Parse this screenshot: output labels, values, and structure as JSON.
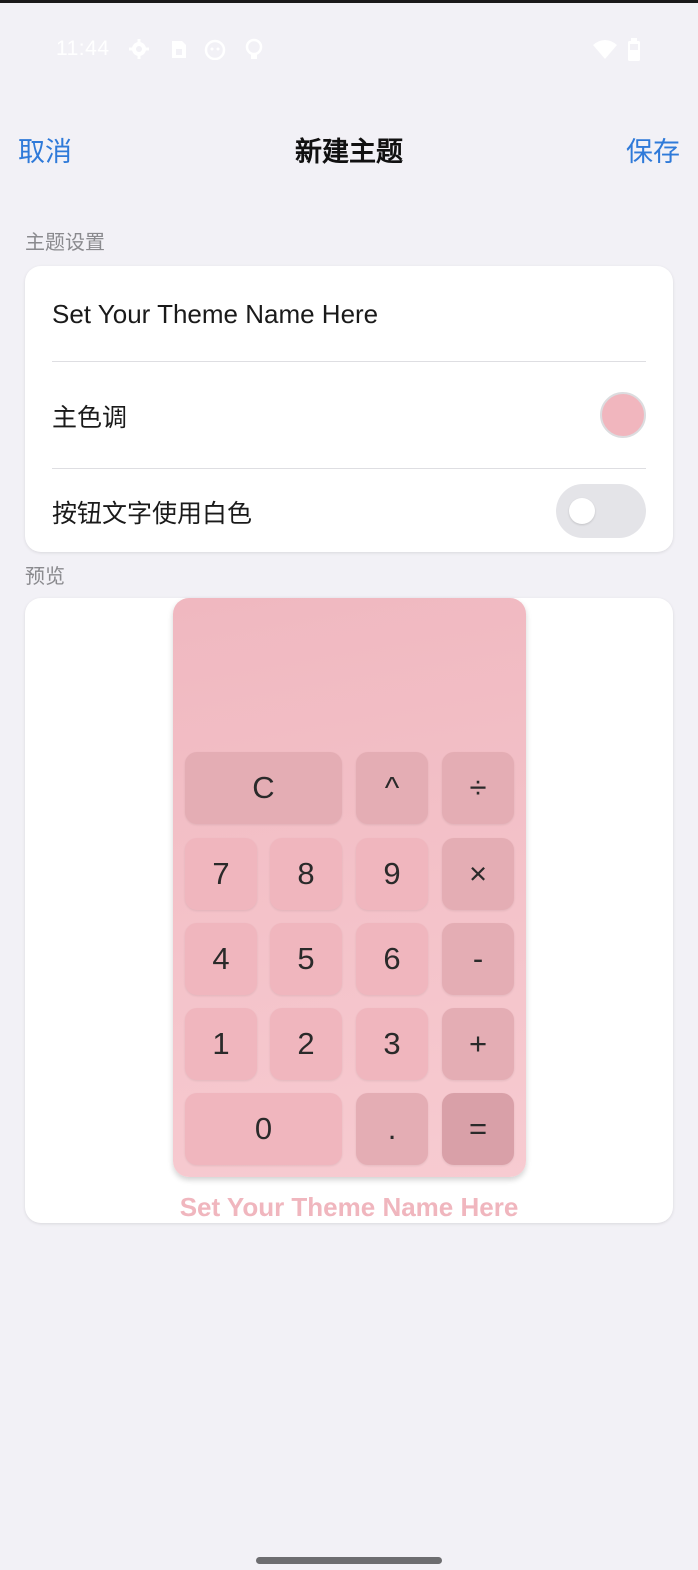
{
  "status_bar": {
    "time": "11:44",
    "icons": [
      "gear-icon",
      "sim-icon",
      "face-icon",
      "bulb-icon"
    ],
    "right_icons": [
      "wifi-icon",
      "battery-icon"
    ]
  },
  "nav": {
    "cancel_label": "取消",
    "title": "新建主题",
    "save_label": "保存"
  },
  "theme_settings": {
    "section_label": "主题设置",
    "name_placeholder": "Set Your Theme Name Here",
    "primary_color_label": "主色调",
    "primary_color": "#f1b6be",
    "white_text_label": "按钮文字使用白色",
    "white_text_enabled": false
  },
  "preview": {
    "section_label": "预览",
    "keys": {
      "clear": "C",
      "power": "^",
      "divide": "÷",
      "seven": "7",
      "eight": "8",
      "nine": "9",
      "multiply": "×",
      "four": "4",
      "five": "5",
      "six": "6",
      "minus": "-",
      "one": "1",
      "two": "2",
      "three": "3",
      "plus": "+",
      "zero": "0",
      "dot": ".",
      "equals": "="
    },
    "theme_name": "Set Your Theme Name Here"
  },
  "colors": {
    "accent": "#2f7ad9",
    "theme_pink": "#f1b6be",
    "background": "#f2f1f6"
  }
}
